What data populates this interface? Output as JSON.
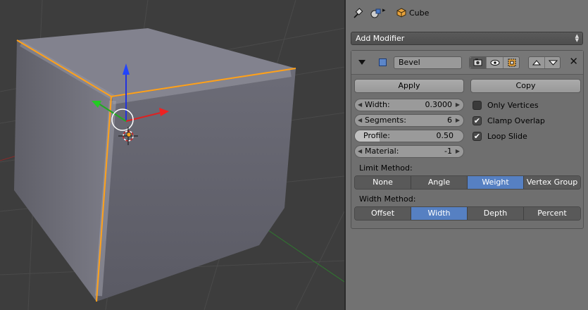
{
  "header": {
    "object_name": "Cube",
    "icons": [
      "pin-icon",
      "object-data-icon",
      "breadcrumb-arrow-icon",
      "cube-object-icon"
    ]
  },
  "add_modifier": {
    "label": "Add Modifier"
  },
  "modifier": {
    "name": "Bevel",
    "header_icons": [
      "collapse-triangle-icon",
      "bevel-modifier-icon",
      "render-camera-icon",
      "viewport-eye-icon",
      "editmode-icon",
      "move-up-icon",
      "move-down-icon",
      "close-icon"
    ],
    "apply_label": "Apply",
    "copy_label": "Copy",
    "fields": {
      "width": {
        "label": "Width:",
        "value": "0.3000"
      },
      "segments": {
        "label": "Segments:",
        "value": "6"
      },
      "profile": {
        "label": "Profile:",
        "value": "0.50",
        "fraction": 0.5
      },
      "material": {
        "label": "Material:",
        "value": "-1"
      }
    },
    "options": {
      "only_vertices": {
        "label": "Only Vertices",
        "checked": false
      },
      "clamp_overlap": {
        "label": "Clamp Overlap",
        "checked": true
      },
      "loop_slide": {
        "label": "Loop Slide",
        "checked": true
      }
    },
    "limit_method": {
      "label": "Limit Method:",
      "options": [
        "None",
        "Angle",
        "Weight",
        "Vertex Group"
      ],
      "selected": "Weight"
    },
    "width_method": {
      "label": "Width Method:",
      "options": [
        "Offset",
        "Width",
        "Depth",
        "Percent"
      ],
      "selected": "Width"
    }
  },
  "colors": {
    "selection_orange": "#ffa11a",
    "active_blue": "#5680c2",
    "viewport_bg": "#3d3d3d",
    "panel_bg": "#727272"
  }
}
